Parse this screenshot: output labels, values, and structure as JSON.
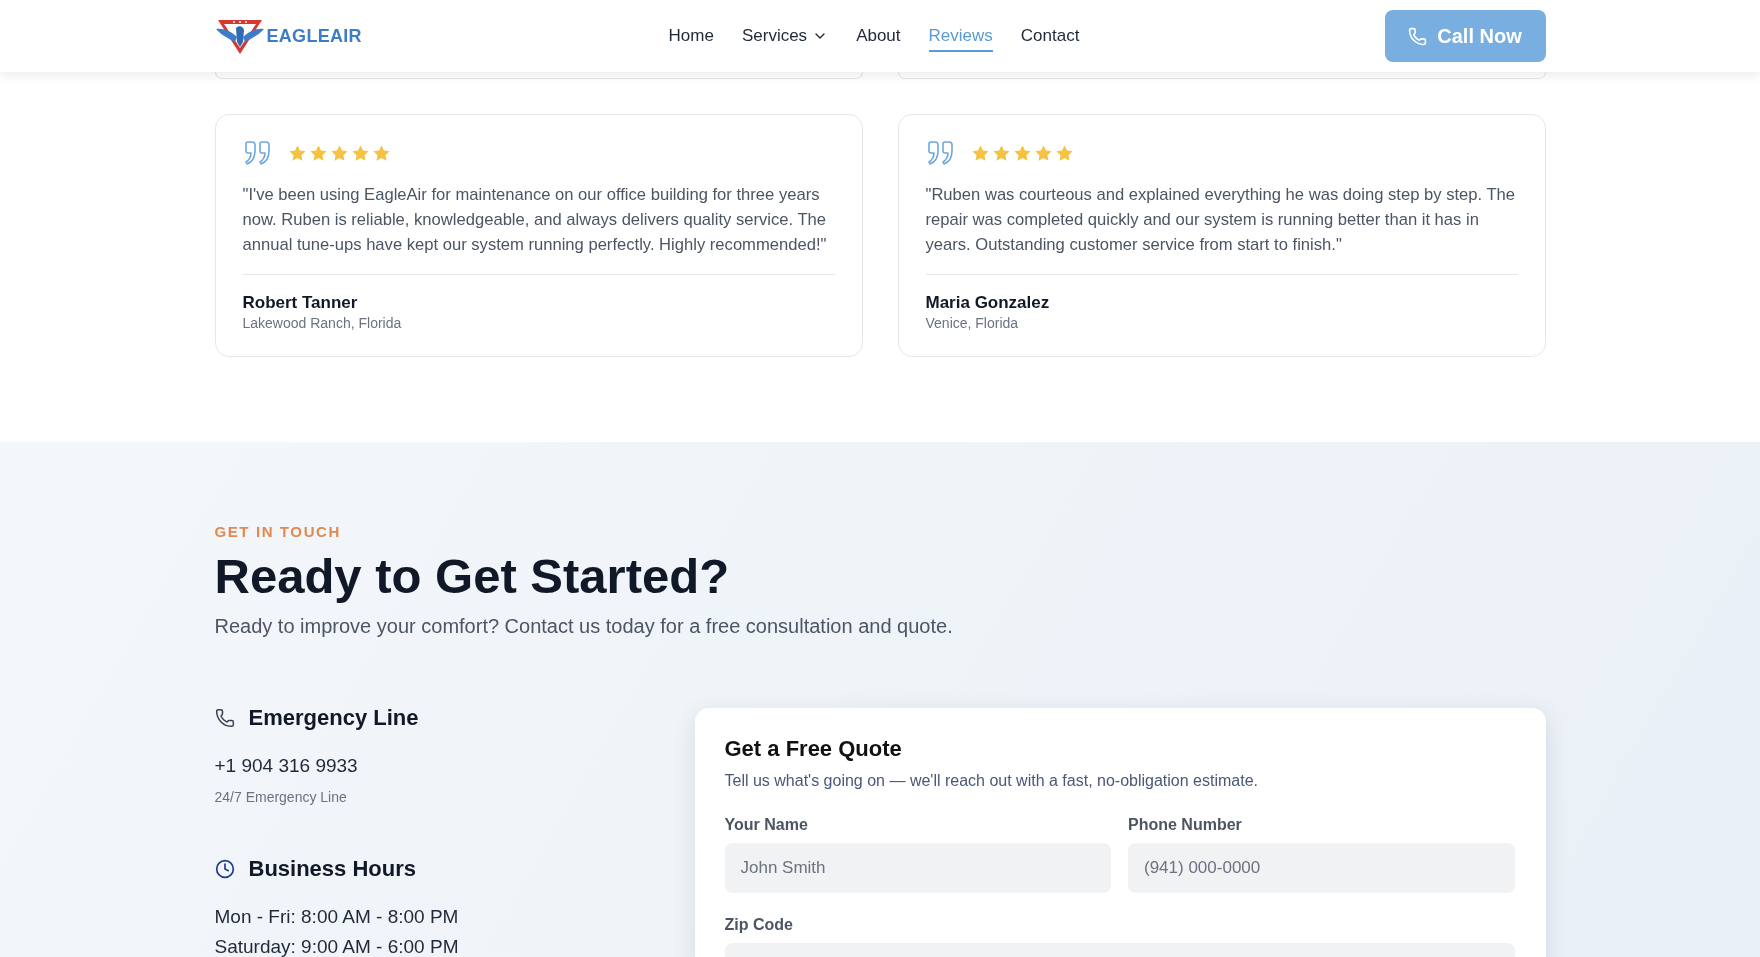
{
  "header": {
    "logo": {
      "text": "EAGLEAIR"
    },
    "nav": [
      {
        "label": "Home",
        "kind": "link",
        "selected": false
      },
      {
        "label": "Services",
        "kind": "dropdown",
        "selected": false
      },
      {
        "label": "About",
        "kind": "link",
        "selected": false
      },
      {
        "label": "Reviews",
        "kind": "link",
        "selected": true
      },
      {
        "label": "Contact",
        "kind": "link",
        "selected": false
      }
    ],
    "call_button": {
      "label": "Call Now"
    }
  },
  "reviews": [
    {
      "stars": 5,
      "quote": "\"I've been using EagleAir for maintenance on our office building for three years now. Ruben is reliable, knowledgeable, and always delivers quality service. The annual tune-ups have kept our system running perfectly. Highly recommended!\"",
      "name": "Robert Tanner",
      "location": "Lakewood Ranch, Florida"
    },
    {
      "stars": 5,
      "quote": "\"Ruben was courteous and explained everything he was doing step by step. The repair was completed quickly and our system is running better than it has in years. Outstanding customer service from start to finish.\"",
      "name": "Maria Gonzalez",
      "location": "Venice, Florida"
    }
  ],
  "contact": {
    "eyebrow": "GET IN TOUCH",
    "title": "Ready to Get Started?",
    "subtitle": "Ready to improve your comfort? Contact us today for a free consultation and quote.",
    "info": [
      {
        "kind": "phone",
        "title": "Emergency Line",
        "lines": [
          {
            "kind": "primary",
            "text": "+1 904 316 9933"
          },
          {
            "kind": "note",
            "text": "24/7 Emergency Line"
          }
        ]
      },
      {
        "kind": "clock",
        "title": "Business Hours",
        "lines": [
          {
            "kind": "primary",
            "text": "Mon - Fri: 8:00 AM - 8:00 PM"
          },
          {
            "kind": "primary",
            "text": "Saturday: 9:00 AM - 6:00 PM"
          }
        ]
      }
    ],
    "quote_form": {
      "title": "Get a Free Quote",
      "subtitle": "Tell us what's going on — we'll reach out with a fast, no-obligation estimate.",
      "rows": [
        [
          {
            "label": "Your Name",
            "placeholder": "John Smith"
          },
          {
            "label": "Phone Number",
            "placeholder": "(941) 000-0000"
          }
        ],
        [
          {
            "label": "Zip Code"
          }
        ]
      ]
    }
  }
}
